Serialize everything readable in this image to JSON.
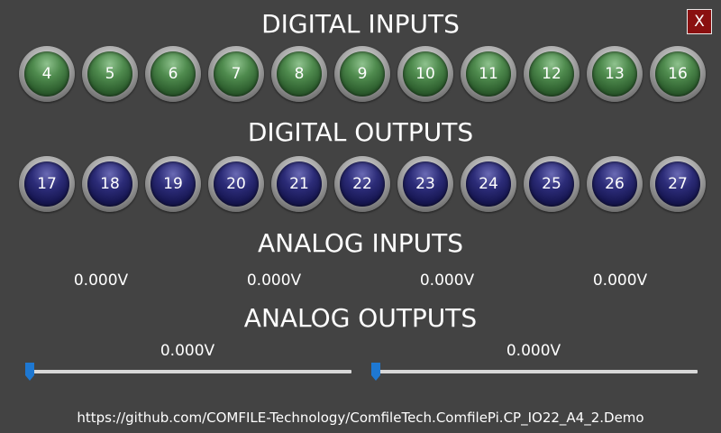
{
  "close_button": {
    "label": "X",
    "color": "#8a1010"
  },
  "digital_inputs": {
    "title": "DIGITAL INPUTS",
    "led_color": "#3f7a3f",
    "channels": [
      "4",
      "5",
      "6",
      "7",
      "8",
      "9",
      "10",
      "11",
      "12",
      "13",
      "16"
    ]
  },
  "digital_outputs": {
    "title": "DIGITAL OUTPUTS",
    "led_color": "#1c1c5e",
    "channels": [
      "17",
      "18",
      "19",
      "20",
      "21",
      "22",
      "23",
      "24",
      "25",
      "26",
      "27"
    ]
  },
  "analog_inputs": {
    "title": "ANALOG INPUTS",
    "values": [
      "0.000V",
      "0.000V",
      "0.000V",
      "0.000V"
    ]
  },
  "analog_outputs": {
    "title": "ANALOG OUTPUTS",
    "accent_color": "#1e78d2",
    "channels": [
      {
        "value": "0.000V",
        "level": 0
      },
      {
        "value": "0.000V",
        "level": 0
      }
    ]
  },
  "footer": {
    "url": "https://github.com/COMFILE-Technology/ComfileTech.ComfilePi.CP_IO22_A4_2.Demo"
  }
}
